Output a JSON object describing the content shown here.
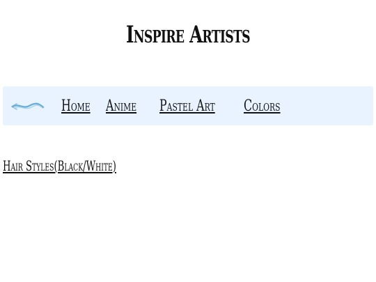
{
  "page": {
    "title": "Inspire Artists"
  },
  "nav": {
    "logo_icon": "brush-stroke-icon",
    "logo_color": "#6aaed6",
    "background": "#e8f3ff",
    "links": [
      {
        "label": "Home"
      },
      {
        "label": "Anime"
      },
      {
        "label": "Pastel Art"
      },
      {
        "label": "Colors"
      }
    ]
  },
  "content": {
    "hair_styles_label": "Hair Styles",
    "black_white_label": "(Black/White)"
  }
}
